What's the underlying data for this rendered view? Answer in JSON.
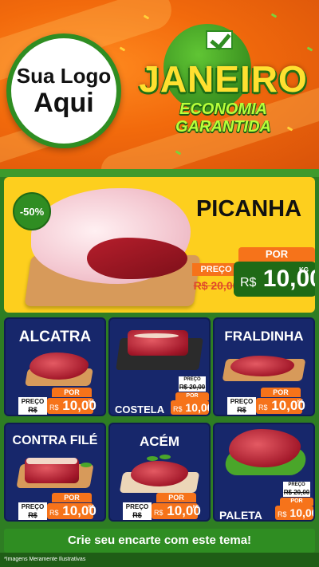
{
  "header": {
    "logo_line1": "Sua Logo",
    "logo_line2": "Aqui",
    "title": "JANEIRO",
    "subtitle": "ECONOMIA GARANTIDA"
  },
  "featured": {
    "discount": "-50%",
    "name": "PICANHA",
    "preco_label": "PREÇO",
    "old_price": "R$ 20,00",
    "por_label": "POR",
    "currency": "R$",
    "price": "10,00",
    "unit": "KG"
  },
  "products": [
    {
      "name": "ALCATRA",
      "preco_label": "PREÇO",
      "old_price": "R$ 20,00",
      "por_label": "POR",
      "currency": "R$",
      "price": "10,00",
      "unit": "KG"
    },
    {
      "name": "COSTELA",
      "preco_label": "PREÇO",
      "old_price": "R$ 20,00",
      "por_label": "POR",
      "currency": "R$",
      "price": "10,00",
      "unit": "KG"
    },
    {
      "name": "FRALDINHA",
      "preco_label": "PREÇO",
      "old_price": "R$ 20,00",
      "por_label": "POR",
      "currency": "R$",
      "price": "10,00",
      "unit": "KG"
    },
    {
      "name": "CONTRA FILÉ",
      "preco_label": "PREÇO",
      "old_price": "R$ 20,00",
      "por_label": "POR",
      "currency": "R$",
      "price": "10,00",
      "unit": "KG"
    },
    {
      "name": "ACÉM",
      "preco_label": "PREÇO",
      "old_price": "R$ 20,00",
      "por_label": "POR",
      "currency": "R$",
      "price": "10,00",
      "unit": "KG"
    },
    {
      "name": "PALETA",
      "preco_label": "PREÇO",
      "old_price": "R$ 20,00",
      "por_label": "POR",
      "currency": "R$",
      "price": "10,00",
      "unit": "KG"
    }
  ],
  "cta": "Crie seu encarte com este tema!",
  "disclaimer": "*Imagens Meramente Ilustrativas",
  "colors": {
    "orange": "#f26a0c",
    "green": "#2f8d22",
    "navy": "#17276b",
    "yellow": "#fdcf1e"
  }
}
